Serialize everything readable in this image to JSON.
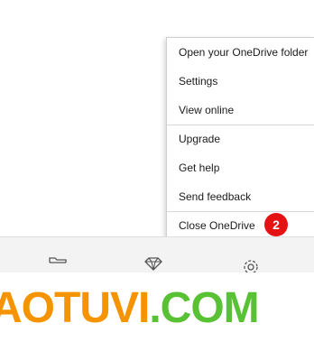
{
  "context_menu": {
    "items": [
      {
        "label": "Open your OneDrive folder"
      },
      {
        "label": "Settings"
      },
      {
        "label": "View online"
      },
      {
        "label": "Upgrade"
      },
      {
        "label": "Get help"
      },
      {
        "label": "Send feedback"
      },
      {
        "label": "Close OneDrive"
      }
    ]
  },
  "step_badge": "2",
  "bottom_bar": {
    "icons": [
      "folder-icon",
      "diamond-icon",
      "gear-icon"
    ]
  },
  "watermark": {
    "part1": "AOTUVI",
    "part2": ".COM",
    "colors": {
      "part1": "#f59300",
      "part2": "#59c134"
    }
  },
  "colors": {
    "badge": "#e41213",
    "menu_text": "#1b1b1b",
    "bar_bg": "#f3f3f3"
  }
}
